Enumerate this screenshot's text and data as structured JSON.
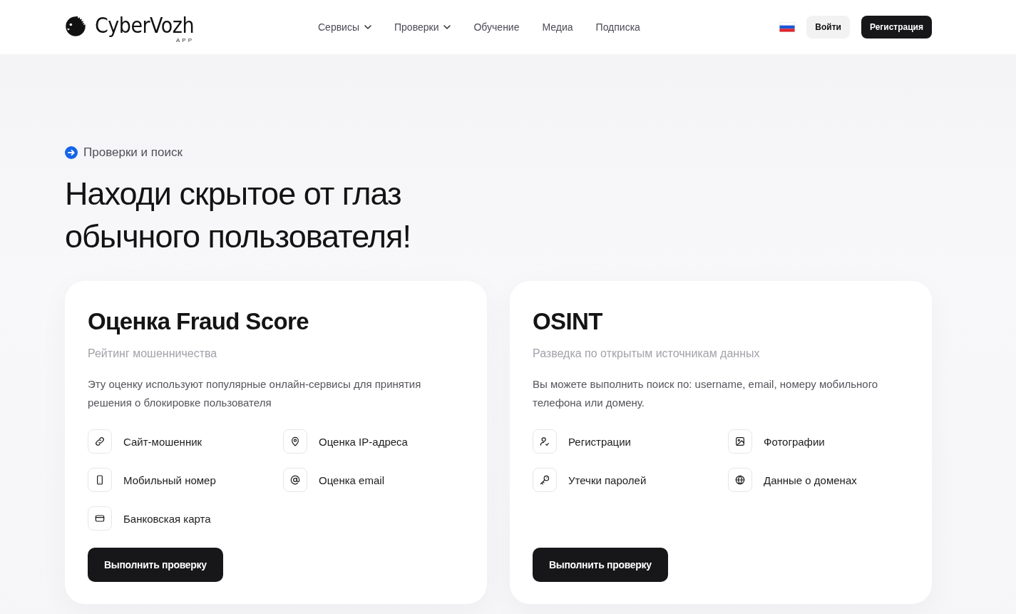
{
  "header": {
    "logo": {
      "text": "CyberVozh",
      "tagline": "APP"
    },
    "nav": [
      {
        "label": "Сервисы",
        "dropdown": true
      },
      {
        "label": "Проверки",
        "dropdown": true
      },
      {
        "label": "Обучение",
        "dropdown": false
      },
      {
        "label": "Медиа",
        "dropdown": false
      },
      {
        "label": "Подписка",
        "dropdown": false
      }
    ],
    "login": "Войти",
    "register": "Регистрация"
  },
  "hero": {
    "eyebrow": "Проверки и поиск",
    "title": "Находи скрытое от глаз обычного пользователя!"
  },
  "cards": [
    {
      "title": "Оценка Fraud Score",
      "subtitle": "Рейтинг мошенничества",
      "description": "Эту оценку используют популярные онлайн-сервисы для принятия решения о блокировке пользователя",
      "features": [
        {
          "kind": "site",
          "label": "Сайт-мошенник"
        },
        {
          "kind": "ip",
          "label": "Оценка IP-адреса"
        },
        {
          "kind": "phone",
          "label": "Мобильный номер"
        },
        {
          "kind": "email",
          "label": "Оценка email"
        },
        {
          "kind": "card",
          "label": "Банковская карта"
        }
      ],
      "button": "Выполнить проверку"
    },
    {
      "title": "OSINT",
      "subtitle": "Разведка по открытым источникам данных",
      "description": "Вы можете выполнить поиск по: username, email, номеру мобильного телефона или домену.",
      "features": [
        {
          "kind": "account",
          "label": "Регистрации"
        },
        {
          "kind": "photo",
          "label": "Фотографии"
        },
        {
          "kind": "password",
          "label": "Утечки паролей"
        },
        {
          "kind": "domain",
          "label": "Данные о доменах"
        }
      ],
      "button": "Выполнить проверку"
    }
  ]
}
